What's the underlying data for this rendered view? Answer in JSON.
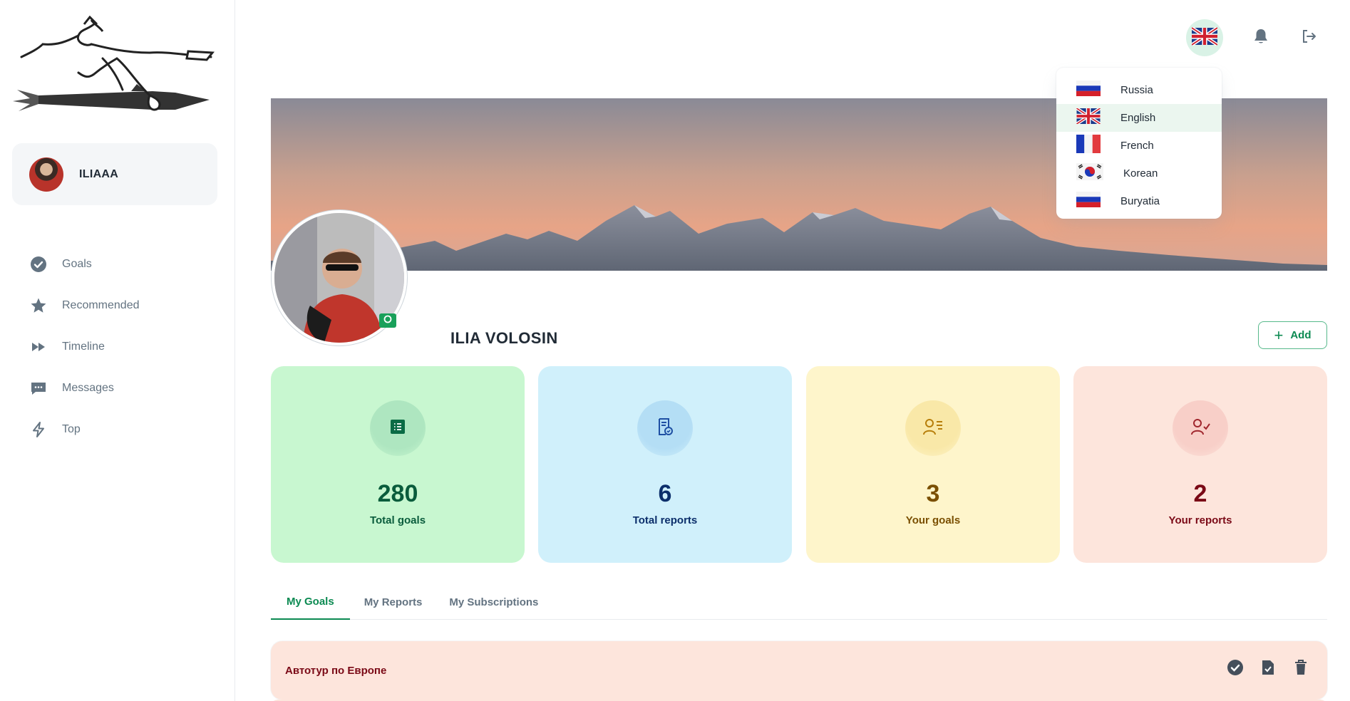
{
  "user": {
    "name": "ILIAAA"
  },
  "nav": {
    "items": [
      {
        "label": "Goals",
        "icon": "check-circle-icon"
      },
      {
        "label": "Recommended",
        "icon": "star-icon"
      },
      {
        "label": "Timeline",
        "icon": "fast-forward-icon"
      },
      {
        "label": "Messages",
        "icon": "chat-icon"
      },
      {
        "label": "Top",
        "icon": "lightning-icon"
      }
    ]
  },
  "topbar": {
    "current_language_icon": "uk-flag-icon",
    "notifications_icon": "bell-icon",
    "logout_icon": "logout-icon"
  },
  "language_menu": {
    "items": [
      {
        "label": "Russia",
        "flag": "russia-flag-icon"
      },
      {
        "label": "English",
        "flag": "uk-flag-icon",
        "selected": true
      },
      {
        "label": "French",
        "flag": "france-flag-icon"
      },
      {
        "label": "Korean",
        "flag": "korea-flag-icon"
      },
      {
        "label": "Buryatia",
        "flag": "russia-flag-icon"
      }
    ]
  },
  "profile": {
    "name": "ILIA VOLOSIN",
    "add_label": "Add"
  },
  "stats": [
    {
      "value": "280",
      "label": "Total goals",
      "bg": "#c8f7d0",
      "icon_bg": "#aee6c0",
      "color": "#0a5c3c"
    },
    {
      "value": "6",
      "label": "Total reports",
      "bg": "#d0f0fb",
      "icon_bg": "#b4def5",
      "color": "#0c2f6b"
    },
    {
      "value": "3",
      "label": "Your goals",
      "bg": "#fef5cb",
      "icon_bg": "#f9e8a8",
      "color": "#7a4f01"
    },
    {
      "value": "2",
      "label": "Your reports",
      "bg": "#fde5dc",
      "icon_bg": "#f8cfc8",
      "color": "#7a0916"
    }
  ],
  "tabs": [
    {
      "label": "My Goals",
      "active": true
    },
    {
      "label": "My Reports"
    },
    {
      "label": "My Subscriptions"
    }
  ],
  "goals": [
    {
      "title": "Автотур по Европе"
    }
  ]
}
